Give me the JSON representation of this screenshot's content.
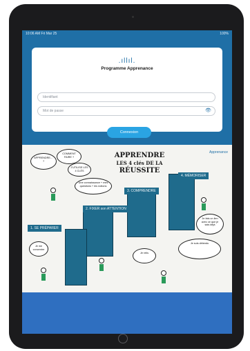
{
  "status_bar": {
    "time": "10:06 AM  Fri Mar 25",
    "battery": "100%"
  },
  "login": {
    "logo_glyph": ".ıllıl.",
    "title": "Programme Apprenance",
    "identifier_placeholder": "Identifiant",
    "password_placeholder": "Mot de passe",
    "submit_label": "Connexion"
  },
  "poster": {
    "title_line1": "APPRENDRE",
    "title_line2": "LES 4 clés DE LA",
    "title_line3": "RÉUSSITE",
    "partner_logo": "Apprenance",
    "steps": [
      "1. SE PRÉPARER",
      "2. FIXER son ATTENTION",
      "3. COMPRENDRE",
      "4. MÉMORISER"
    ],
    "bubbles": [
      "APPRENDRE… ?",
      "COMMENT FAIRE ?",
      "J'UTILISE LES 4 CLÉS",
      "Je suis détendu",
      "Je fais un lien avec ce que je sais déjà",
      "Une connaissance + mes questions + les notions",
      "Je relis",
      "Je me concentre"
    ]
  },
  "colors": {
    "screen_bg": "#1f6fa6",
    "accent": "#2aa4e3",
    "panel": "#1f6b8c",
    "bottom_band": "#2f6fc0"
  },
  "icons": {
    "eye": "eye-icon",
    "logo": "logo-icon",
    "key": "key-icon"
  }
}
